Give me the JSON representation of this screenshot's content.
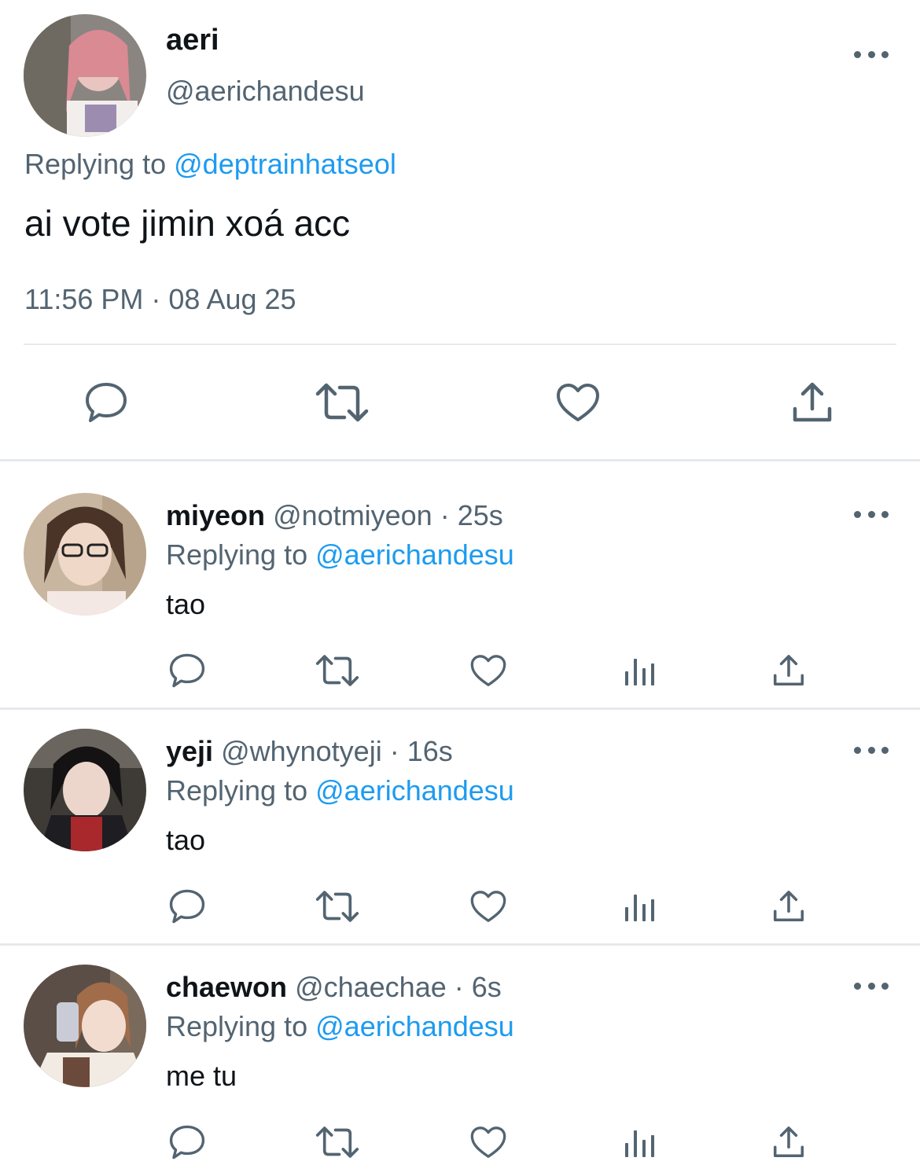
{
  "main_tweet": {
    "name": "aeri",
    "handle": "@aerichandesu",
    "replying_prefix": "Replying to",
    "replying_to": "@deptrainhatseol",
    "text": "ai vote jimin xoá acc",
    "timestamp": "11:56 PM · 08 Aug 25",
    "actions": [
      "reply-icon",
      "retweet-icon",
      "like-icon",
      "share-icon"
    ]
  },
  "replies": [
    {
      "name": "miyeon",
      "handle": "@notmiyeon",
      "age": "· 25s",
      "replying_prefix": "Replying to",
      "replying_to": "@aerichandesu",
      "text": "tao"
    },
    {
      "name": "yeji",
      "handle": "@whynotyeji",
      "age": "· 16s",
      "replying_prefix": "Replying to",
      "replying_to": "@aerichandesu",
      "text": "tao"
    },
    {
      "name": "chaewon",
      "handle": "@chaechae",
      "age": "· 6s",
      "replying_prefix": "Replying to",
      "replying_to": "@aerichandesu",
      "text": "me tu"
    }
  ],
  "colors": {
    "text": "#0f1419",
    "secondary": "#536471",
    "link": "#1d9bf0",
    "divider": "#e6e9ec"
  }
}
